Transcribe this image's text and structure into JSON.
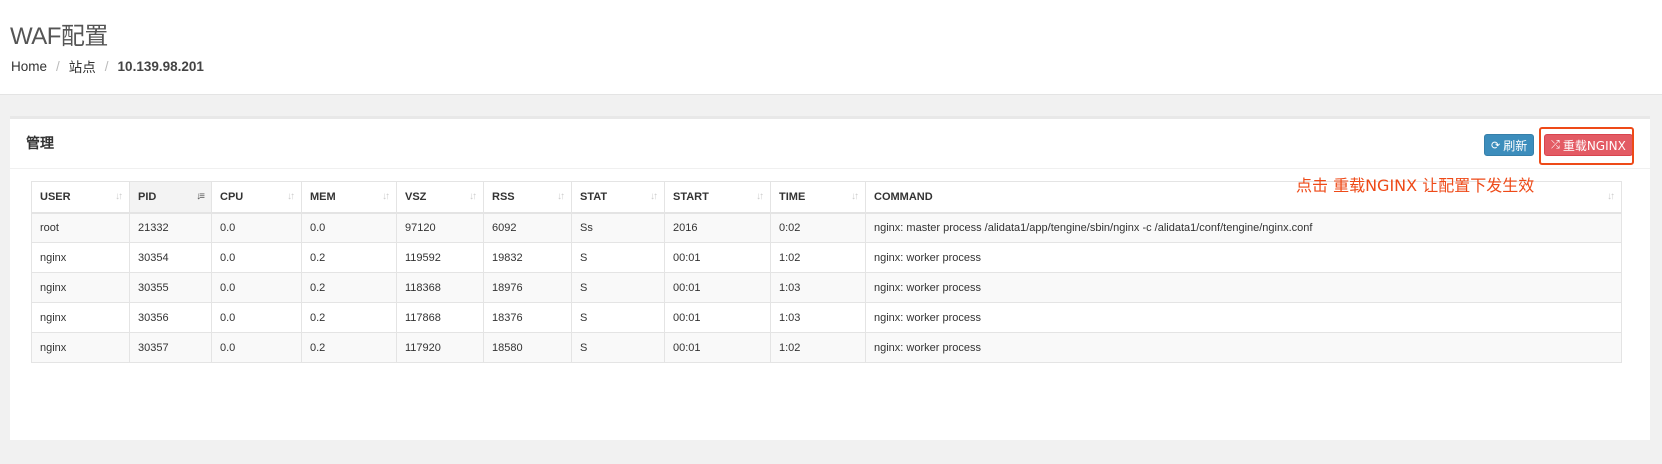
{
  "header": {
    "title": "WAF配置",
    "breadcrumb": [
      "Home",
      "站点",
      "10.139.98.201"
    ]
  },
  "box": {
    "title": "管理",
    "refresh_label": "刷新",
    "reload_label": "重载NGINX",
    "refresh_icon": "refresh-icon",
    "reload_icon": "shuffle-icon",
    "annotation": "点击 重载NGINX 让配置下发生效"
  },
  "colors": {
    "refresh": "#3c8dbc",
    "reload": "#e35b64",
    "annotation": "#ee4a18"
  },
  "table": {
    "columns": [
      "USER",
      "PID",
      "CPU",
      "MEM",
      "VSZ",
      "RSS",
      "STAT",
      "START",
      "TIME",
      "COMMAND"
    ],
    "sorted_column": "PID",
    "rows": [
      [
        "root",
        "21332",
        "0.0",
        "0.0",
        "97120",
        "6092",
        "Ss",
        "2016",
        "0:02",
        "nginx: master process /alidata1/app/tengine/sbin/nginx -c /alidata1/conf/tengine/nginx.conf"
      ],
      [
        "nginx",
        "30354",
        "0.0",
        "0.2",
        "119592",
        "19832",
        "S",
        "00:01",
        "1:02",
        "nginx: worker process"
      ],
      [
        "nginx",
        "30355",
        "0.0",
        "0.2",
        "118368",
        "18976",
        "S",
        "00:01",
        "1:03",
        "nginx: worker process"
      ],
      [
        "nginx",
        "30356",
        "0.0",
        "0.2",
        "117868",
        "18376",
        "S",
        "00:01",
        "1:03",
        "nginx: worker process"
      ],
      [
        "nginx",
        "30357",
        "0.0",
        "0.2",
        "117920",
        "18580",
        "S",
        "00:01",
        "1:02",
        "nginx: worker process"
      ]
    ]
  }
}
